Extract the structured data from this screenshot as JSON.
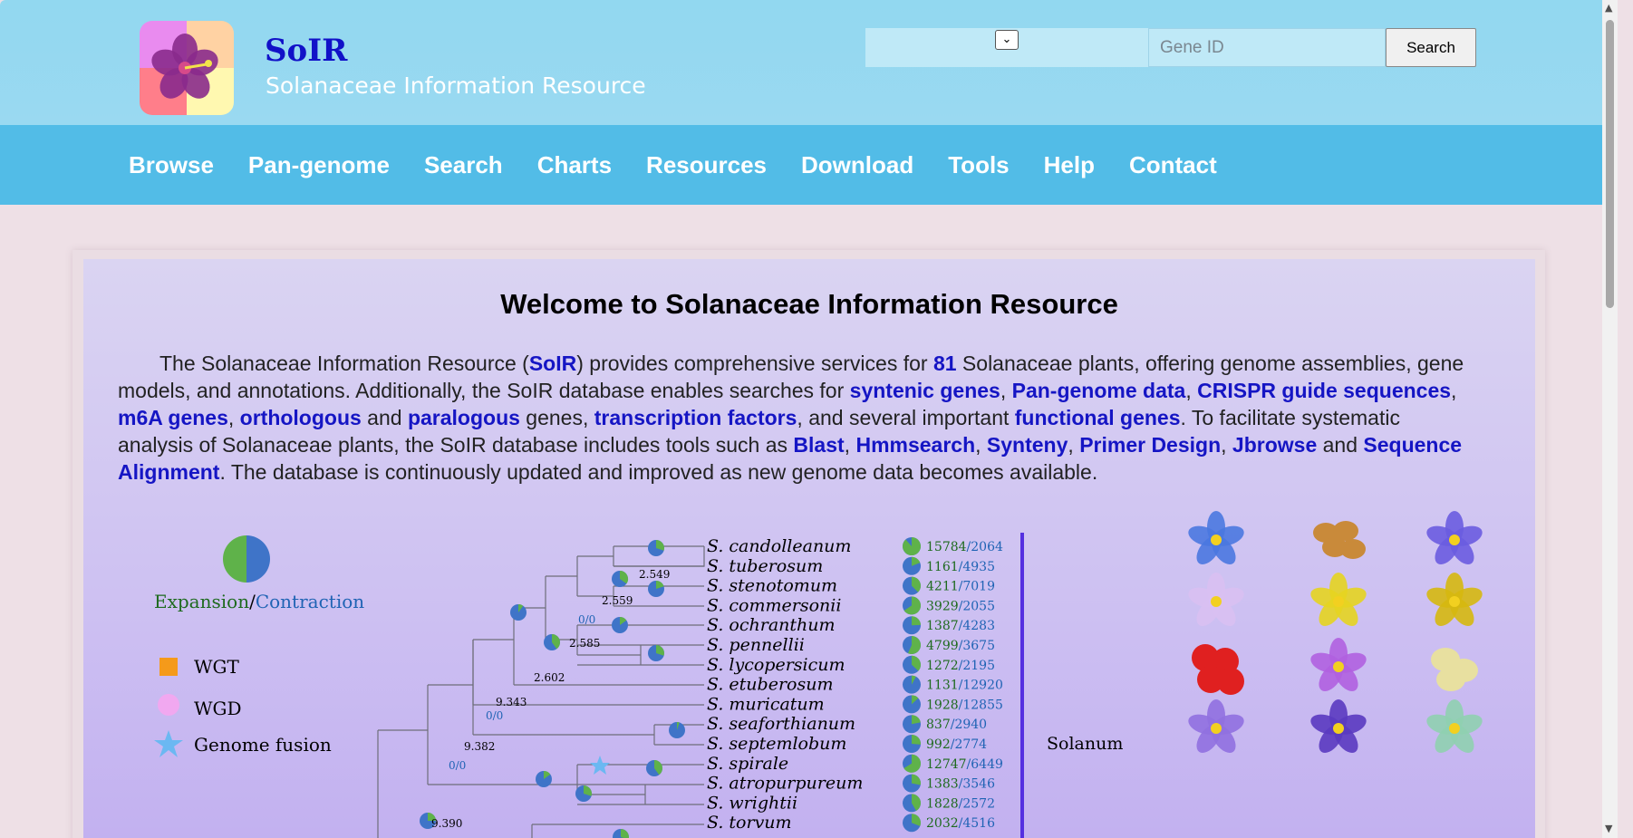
{
  "site": {
    "name": "SoIR",
    "subtitle": "Solanaceae Information Resource"
  },
  "search": {
    "placeholder": "Gene ID",
    "button": "Search",
    "dropdown_glyph": "⌄"
  },
  "nav": [
    "Browse",
    "Pan-genome",
    "Search",
    "Charts",
    "Resources",
    "Download",
    "Tools",
    "Help",
    "Contact"
  ],
  "welcome": "Welcome to Solanaceae Information Resource",
  "intro": {
    "t1": "The Solanaceae Information Resource (",
    "l_soir": "SoIR",
    "t2": ") provides comprehensive services for ",
    "l_81": "81",
    "t3": " Solanaceae plants, offering genome assemblies, gene models, and annotations. Additionally, the SoIR database enables searches for ",
    "l_syntenic": "syntenic genes",
    "t4": ", ",
    "l_pan": "Pan-genome data",
    "t5": ", ",
    "l_crispr": "CRISPR guide sequences",
    "t6": ", ",
    "l_m6a": "m6A genes",
    "t7": ", ",
    "l_ortho": "orthologous",
    "t8": " and ",
    "l_para": "paralogous",
    "t9": " genes, ",
    "l_tf": "transcription factors",
    "t10": ", and several important ",
    "l_func": "functional genes",
    "t11": ". To facilitate systematic analysis of Solanaceae plants, the SoIR database includes tools such as ",
    "l_blast": "Blast",
    "t12": ", ",
    "l_hmm": "Hmmsearch",
    "t13": ", ",
    "l_syn": "Synteny",
    "t14": ", ",
    "l_primer": "Primer Design",
    "t15": ", ",
    "l_jb": "Jbrowse",
    "t16": " and ",
    "l_align": "Sequence Alignment",
    "t17": ". The database is continuously updated and improved as new genome data becomes available."
  },
  "legend": {
    "expansion": "Expansion",
    "sep": "/",
    "contraction": "Contraction",
    "wgt": "WGT",
    "wgd": "WGD",
    "fusion": "Genome fusion"
  },
  "colors": {
    "expansion": "#5fb24a",
    "contraction": "#3f74c8",
    "wgt": "#f59a1a",
    "wgd": "#f1a8f0",
    "fusion": "#6bb8f2",
    "link": "#1515c4"
  },
  "genus_label": "Solanum",
  "node_labels": [
    "2.549",
    "2.559",
    "2.585",
    "2.602",
    "9.343",
    "9.382",
    "9.390",
    "0/0",
    "0/0",
    "0/0"
  ],
  "species": [
    {
      "name": "S. candolleanum",
      "exp": "15784",
      "con": "2064"
    },
    {
      "name": "S. tuberosum",
      "exp": "1161",
      "con": "4935"
    },
    {
      "name": "S. stenotomum",
      "exp": "4211",
      "con": "7019"
    },
    {
      "name": "S. commersonii",
      "exp": "3929",
      "con": "2055"
    },
    {
      "name": "S. ochranthum",
      "exp": "1387",
      "con": "4283"
    },
    {
      "name": "S. pennellii",
      "exp": "4799",
      "con": "3675"
    },
    {
      "name": "S. lycopersicum",
      "exp": "1272",
      "con": "2195"
    },
    {
      "name": "S. etuberosum",
      "exp": "1131",
      "con": "12920"
    },
    {
      "name": "S. muricatum",
      "exp": "1928",
      "con": "12855"
    },
    {
      "name": "S. seaforthianum",
      "exp": "837",
      "con": "2940"
    },
    {
      "name": "S. septemlobum",
      "exp": "992",
      "con": "2774"
    },
    {
      "name": "S. spirale",
      "exp": "12747",
      "con": "6449"
    },
    {
      "name": "S. atropurpureum",
      "exp": "1383",
      "con": "3546"
    },
    {
      "name": "S. wrightii",
      "exp": "1828",
      "con": "2572"
    },
    {
      "name": "S. torvum",
      "exp": "2032",
      "con": "4516"
    }
  ]
}
